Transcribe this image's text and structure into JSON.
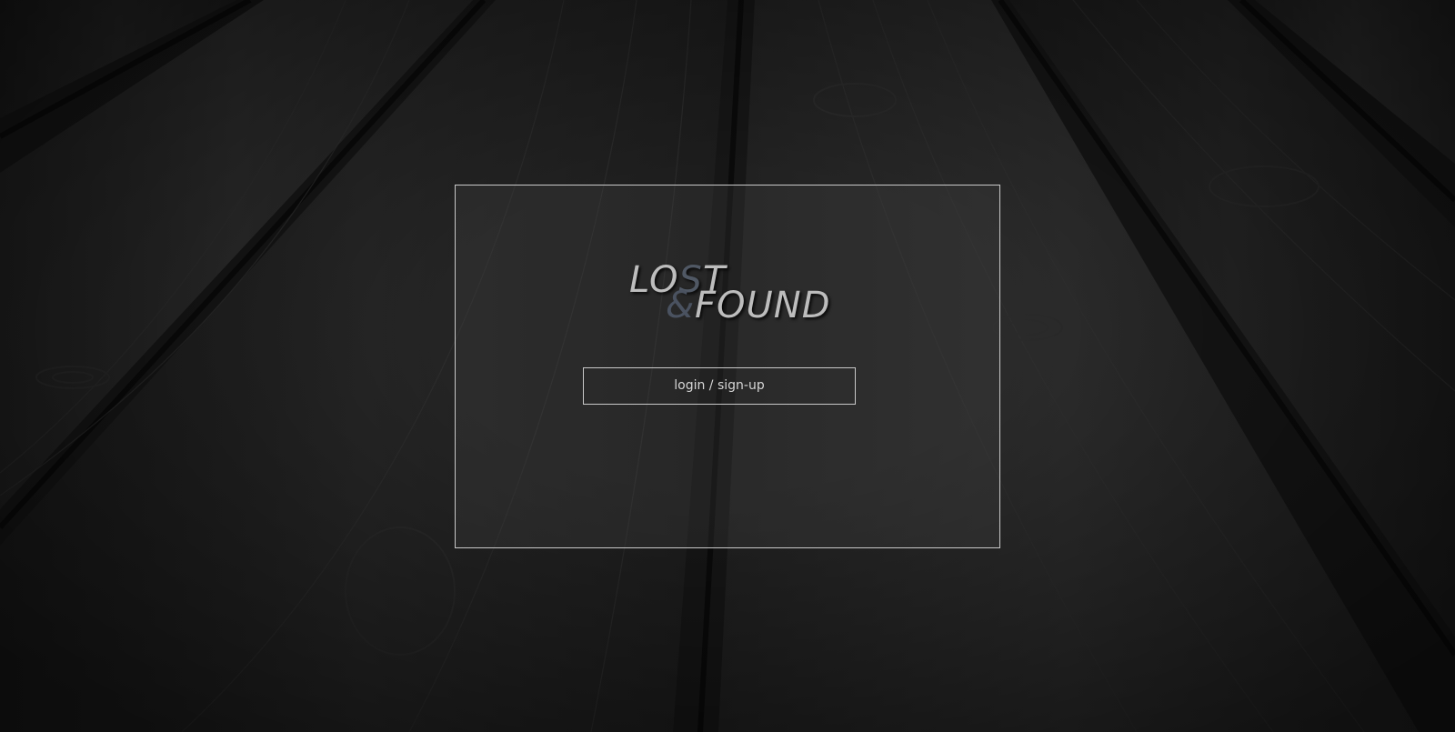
{
  "background": {
    "description_icon": "dark-wood-planks-background"
  },
  "logo": {
    "text_lo": "LO",
    "text_s": "S",
    "text_t": "T",
    "text_amp": "&",
    "text_found": "FOUND"
  },
  "login": {
    "button_label": "login / sign-up"
  },
  "colors": {
    "panel_border": "#c9c9c9",
    "logo_light": "#bdbdbd",
    "logo_accent": "#4a5260",
    "button_text": "#d6d6d6"
  }
}
